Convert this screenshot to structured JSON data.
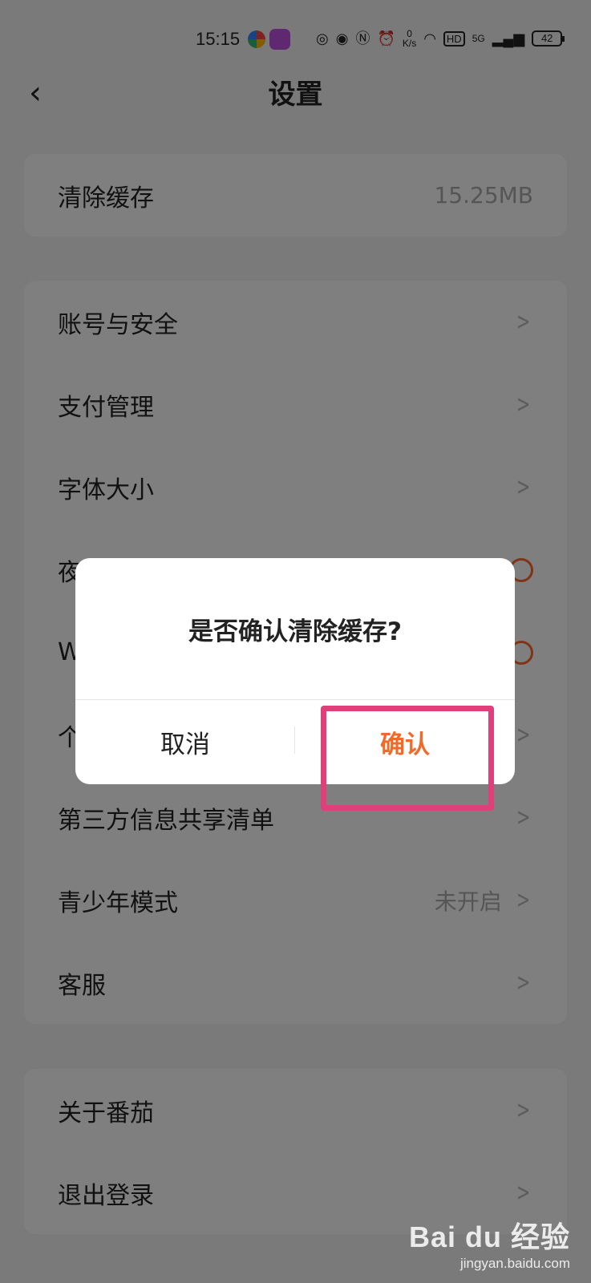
{
  "status_bar": {
    "time": "15:15",
    "net_speed_value": "0",
    "net_speed_unit": "K/s",
    "hd_label": "HD",
    "network_label": "5G",
    "battery": "42"
  },
  "nav": {
    "title": "设置",
    "back_icon": "‹"
  },
  "cache_card": {
    "label": "清除缓存",
    "value": "15.25MB"
  },
  "settings_list": [
    {
      "label": "账号与安全",
      "value": ""
    },
    {
      "label": "支付管理",
      "value": ""
    },
    {
      "label": "字体大小",
      "value": ""
    },
    {
      "label": "夜",
      "value": ""
    },
    {
      "label": "W",
      "value": ""
    },
    {
      "label": "个",
      "value": ""
    },
    {
      "label": "第三方信息共享清单",
      "value": ""
    },
    {
      "label": "青少年模式",
      "value": "未开启"
    },
    {
      "label": "客服",
      "value": ""
    }
  ],
  "about_card": [
    {
      "label": "关于番茄"
    },
    {
      "label": "退出登录"
    }
  ],
  "dialog": {
    "message": "是否确认清除缓存?",
    "cancel_label": "取消",
    "confirm_label": "确认"
  },
  "watermark": {
    "logo": "Bai du 经验",
    "url": "jingyan.baidu.com"
  },
  "colors": {
    "accent": "#f06a2a",
    "highlight": "#e0407a"
  }
}
